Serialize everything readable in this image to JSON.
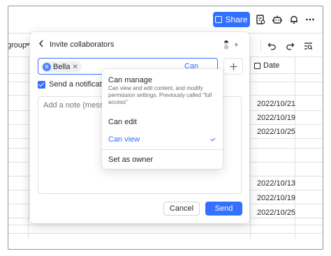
{
  "toolbar": {
    "share_label": "Share",
    "icons": [
      "share-icon",
      "doc-info-icon",
      "bot-icon",
      "bell-icon",
      "more-icon"
    ]
  },
  "sheet": {
    "group_label": "group",
    "date_column_label": "Date",
    "date_cells_top": [
      "2022/10/21",
      "2022/10/19",
      "2022/10/25"
    ],
    "date_cells_bottom": [
      "2022/10/13",
      "2022/10/19",
      "2022/10/25"
    ]
  },
  "modal": {
    "title": "Invite collaborators",
    "invitee_name": "Bella",
    "permission_value": "Can view",
    "notify_label": "Send a notification",
    "note_placeholder": "Add a note (message)",
    "cancel_label": "Cancel",
    "send_label": "Send"
  },
  "dropdown": {
    "manage_label": "Can manage",
    "manage_desc": "Can view and edit content, and modify permission settings. Previously called \"full access\"",
    "edit_label": "Can edit",
    "view_label": "Can view",
    "owner_label": "Set as owner",
    "selected": "Can view"
  },
  "colors": {
    "accent": "#3370ff",
    "border": "#dee0e3",
    "text": "#1f2329",
    "muted": "#646a73"
  }
}
